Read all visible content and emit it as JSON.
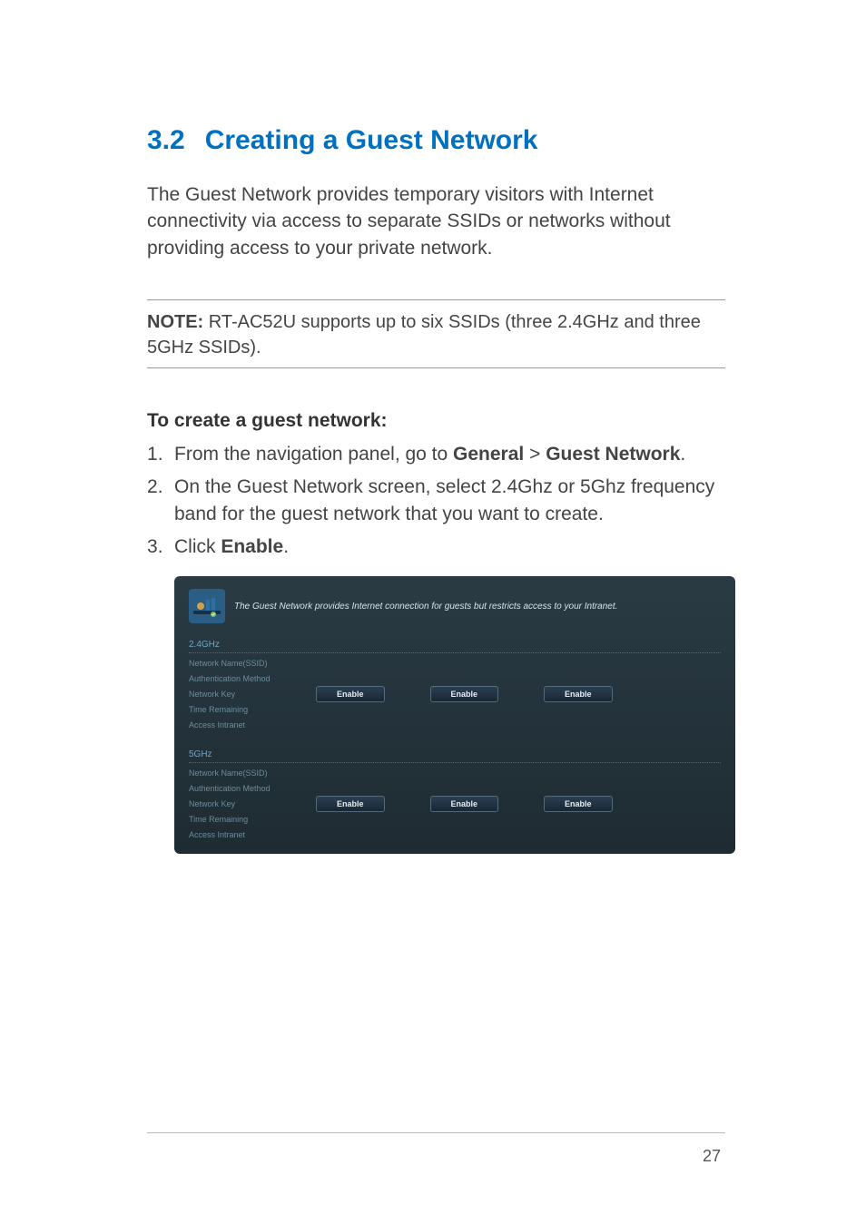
{
  "section": {
    "number": "3.2",
    "title": "Creating a Guest Network"
  },
  "intro": "The Guest Network provides temporary visitors with Internet connectivity via access to separate SSIDs or networks without providing access to your private network.",
  "note": {
    "label": "NOTE:",
    "text": " RT-AC52U supports up to six SSIDs (three 2.4GHz and three 5GHz SSIDs)."
  },
  "subhead": "To create a guest network:",
  "steps": [
    {
      "pre": "From the navigation panel, go to ",
      "b1": "General",
      "mid": " > ",
      "b2": "Guest Network",
      "post": "."
    },
    {
      "pre": "On the Guest Network screen, select 2.4Ghz or 5Ghz frequency band for the guest network that you want to create.",
      "b1": "",
      "mid": "",
      "b2": "",
      "post": ""
    },
    {
      "pre": "Click ",
      "b1": "Enable",
      "mid": "",
      "b2": "",
      "post": "."
    }
  ],
  "screenshot": {
    "desc": "The Guest Network provides Internet connection for guests but restricts access to your Intranet.",
    "bands": [
      {
        "title": "2.4GHz",
        "labels": [
          "Network Name(SSID)",
          "Authentication Method",
          "Network Key",
          "Time Remaining",
          "Access Intranet"
        ],
        "buttons": [
          "Enable",
          "Enable",
          "Enable"
        ]
      },
      {
        "title": "5GHz",
        "labels": [
          "Network Name(SSID)",
          "Authentication Method",
          "Network Key",
          "Time Remaining",
          "Access Intranet"
        ],
        "buttons": [
          "Enable",
          "Enable",
          "Enable"
        ]
      }
    ]
  },
  "page_number": "27"
}
